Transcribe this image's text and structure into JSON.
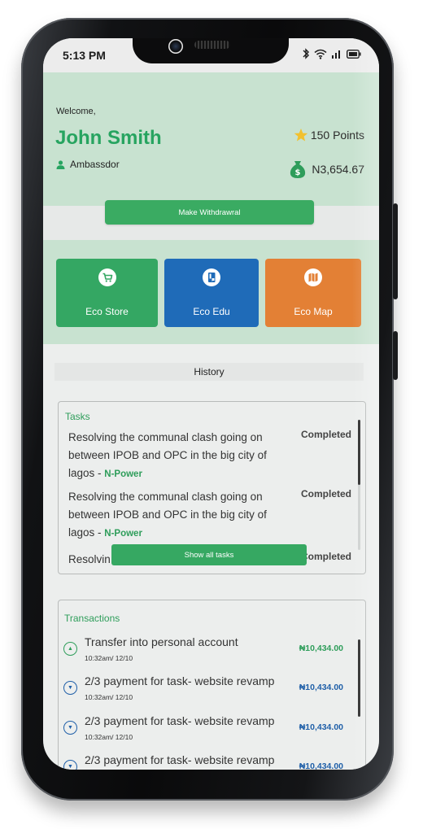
{
  "status_bar": {
    "time": "5:13 PM"
  },
  "header": {
    "welcome": "Welcome,",
    "user_name": "John Smith",
    "role": "Ambassdor",
    "points": "150 Points",
    "balance": "N3,654.67"
  },
  "withdraw_button": "Make Withdrawral",
  "tiles": [
    {
      "label": "Eco Store",
      "icon": "cart-icon"
    },
    {
      "label": "Eco Edu",
      "icon": "book-icon"
    },
    {
      "label": "Eco Map",
      "icon": "map-icon"
    }
  ],
  "history_label": "History",
  "tasks": {
    "title": "Tasks",
    "items": [
      {
        "text": "Resolving the communal clash going on between IPOB and OPC in the big city of lagos - ",
        "tag": "N-Power",
        "status": "Completed"
      },
      {
        "text": "Resolving the communal clash going on between IPOB and OPC in the big city of lagos - ",
        "tag": "N-Power",
        "status": "Completed"
      },
      {
        "text": "Resolvin",
        "tag": "",
        "status": "Completed"
      }
    ],
    "show_all_button": "Show all tasks"
  },
  "transactions": {
    "title": "Transactions",
    "items": [
      {
        "direction": "up",
        "title": "Transfer into personal account",
        "time": "10:32am/ 12/10",
        "amount": "₦10,434.00",
        "color": "#2e9d5a"
      },
      {
        "direction": "down",
        "title": "2/3 payment for task- website revamp",
        "time": "10:32am/ 12/10",
        "amount": "₦10,434.00",
        "color": "#1f5fa8"
      },
      {
        "direction": "down",
        "title": "2/3 payment for task- website revamp",
        "time": "10:32am/ 12/10",
        "amount": "₦10,434.00",
        "color": "#1f5fa8"
      },
      {
        "direction": "down",
        "title": "2/3 payment for task- website revamp",
        "time": "",
        "amount": "₦10,434.00",
        "color": "#1f5fa8"
      }
    ]
  },
  "colors": {
    "brand_green": "#27a460",
    "edu_blue": "#1f6bb8",
    "map_orange": "#e38035",
    "header_bg": "#c8e2d0"
  }
}
